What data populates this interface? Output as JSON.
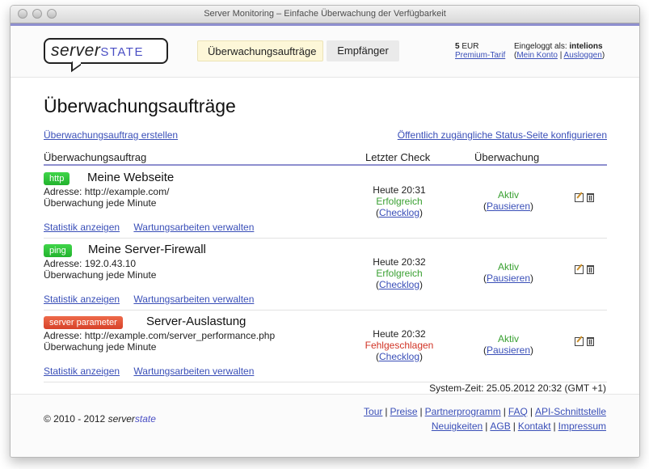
{
  "window": {
    "title": "Server Monitoring – Einfache Überwachung der Verfügbarkeit"
  },
  "header": {
    "logo": {
      "part1": "server",
      "part2": "state"
    },
    "tabs": [
      {
        "label": "Überwachungsaufträge",
        "active": true
      },
      {
        "label": "Empfänger",
        "active": false
      }
    ],
    "credit": {
      "amount": "5",
      "currency": "EUR",
      "plan": "Premium-Tarif"
    },
    "login": {
      "prefix": "Eingeloggt als:",
      "user": "intelions",
      "account_link": "Mein Konto",
      "logout_link": "Ausloggen"
    }
  },
  "main": {
    "title": "Überwachungsaufträge",
    "create_link": "Überwachungsauftrag erstellen",
    "status_page_link": "Öffentlich zugängliche Status-Seite konfigurieren",
    "columns": [
      "Überwachungsauftrag",
      "Letzter Check",
      "Überwachung"
    ],
    "jobs": [
      {
        "badge": "http",
        "badge_color": "#22b32d",
        "name": "Meine Webseite",
        "address": "Adresse: http://example.com/",
        "interval": "Überwachung jede Minute",
        "check_time": "Heute 20:31",
        "check_status": "Erfolgreich",
        "check_ok": true,
        "checklog": "Checklog",
        "monitor_status": "Aktiv",
        "pause": "Pausieren",
        "stats_link": "Statistik anzeigen",
        "maintenance_link": "Wartungsarbeiten verwalten"
      },
      {
        "badge": "ping",
        "badge_color": "#22b32d",
        "name": "Meine Server-Firewall",
        "address": "Adresse: 192.0.43.10",
        "interval": "Überwachung jede Minute",
        "check_time": "Heute 20:32",
        "check_status": "Erfolgreich",
        "check_ok": true,
        "checklog": "Checklog",
        "monitor_status": "Aktiv",
        "pause": "Pausieren",
        "stats_link": "Statistik anzeigen",
        "maintenance_link": "Wartungsarbeiten verwalten"
      },
      {
        "badge": "server parameter",
        "badge_color": "#d7412a",
        "name": "Server-Auslastung",
        "address": "Adresse: http://example.com/server_performance.php",
        "interval": "Überwachung jede Minute",
        "check_time": "Heute 20:32",
        "check_status": "Fehlgeschlagen",
        "check_ok": false,
        "checklog": "Checklog",
        "monitor_status": "Aktiv",
        "pause": "Pausieren",
        "stats_link": "Statistik anzeigen",
        "maintenance_link": "Wartungsarbeiten verwalten"
      }
    ],
    "system_time": "System-Zeit: 25.05.2012 20:32 (GMT +1)"
  },
  "footer": {
    "copyright_prefix": "© 2010 - 2012 ",
    "brand_part1": "server",
    "brand_part2": "state",
    "links_row1": [
      "Tour",
      "Preise",
      "Partnerprogramm",
      "FAQ",
      "API-Schnittstelle"
    ],
    "links_row2": [
      "Neuigkeiten",
      "AGB",
      "Kontakt",
      "Impressum"
    ]
  },
  "colors": {
    "accent": "#8e8fcf",
    "link": "#3a4fb8",
    "success": "#3aa032",
    "failure": "#d13325"
  }
}
